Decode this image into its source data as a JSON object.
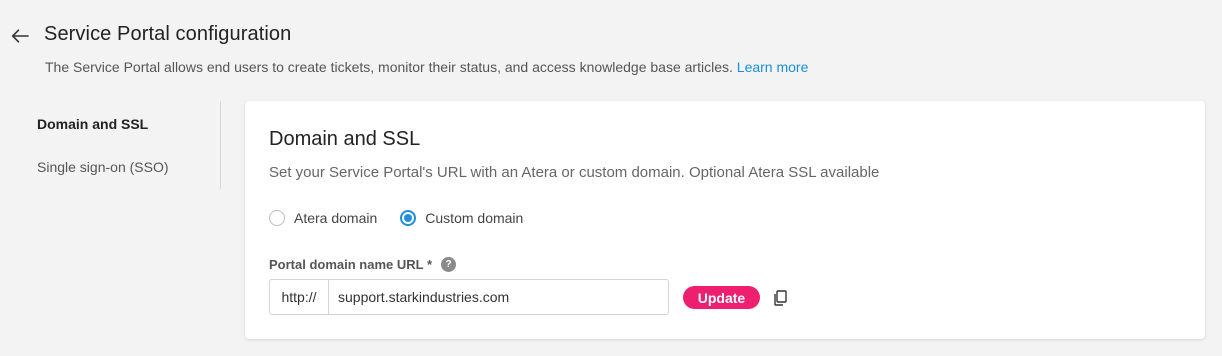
{
  "header": {
    "title": "Service Portal configuration",
    "description": "The Service Portal allows end users to create tickets, monitor their status, and access knowledge base articles.",
    "learn_more": "Learn more",
    "back_icon": "arrow-left-icon"
  },
  "sidebar": {
    "items": [
      {
        "label": "Domain and SSL",
        "active": true
      },
      {
        "label": "Single sign-on (SSO)",
        "active": false
      }
    ]
  },
  "card": {
    "title": "Domain and SSL",
    "subtitle": "Set your Service Portal's URL with an Atera or custom domain. Optional Atera SSL available",
    "radio_options": [
      {
        "label": "Atera domain",
        "checked": false
      },
      {
        "label": "Custom domain",
        "checked": true
      }
    ],
    "field_label": "Portal domain name URL *",
    "help_icon": "question-circle-icon",
    "url_prefix": "http://",
    "url_value": "support.starkindustries.com",
    "update_label": "Update",
    "copy_icon": "copy-icon"
  },
  "colors": {
    "accent_blue": "#1e8fdb",
    "link_blue": "#1a8fdc",
    "update_pink": "#ee1f6f",
    "background": "#f3f3f3"
  }
}
